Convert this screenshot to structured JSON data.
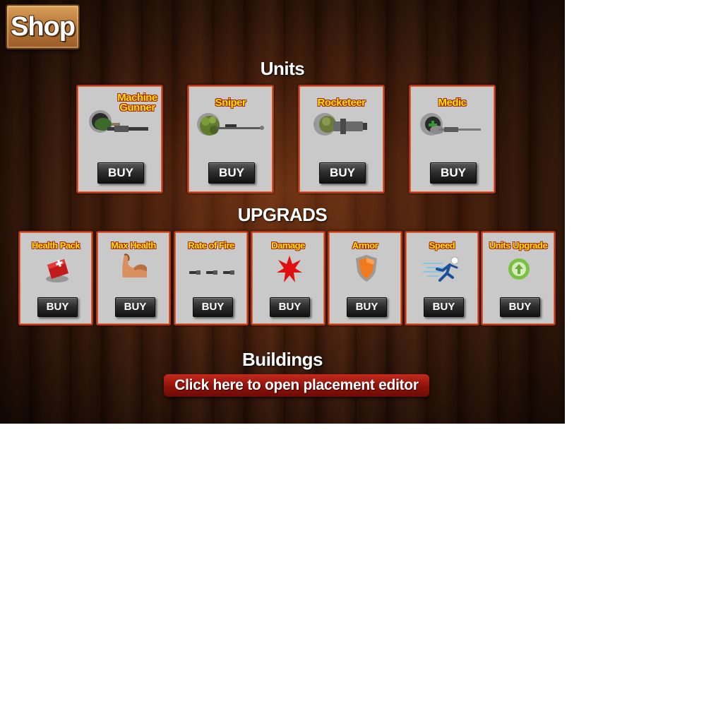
{
  "shop": {
    "title": "Shop"
  },
  "sections": {
    "units": "Units",
    "upgrades": "UPGRADS",
    "buildings": "Buildings"
  },
  "units": [
    {
      "name": "Machine Gunner",
      "line1": "Machine",
      "line2": "Gunner",
      "icon": "machine-gunner-soldier",
      "buy": "BUY"
    },
    {
      "name": "Sniper",
      "icon": "sniper-soldier",
      "buy": "BUY"
    },
    {
      "name": "Rocketeer",
      "icon": "rocketeer-soldier",
      "buy": "BUY"
    },
    {
      "name": "Medic",
      "icon": "medic-soldier",
      "buy": "BUY"
    }
  ],
  "upgrades": [
    {
      "name": "Health Pack",
      "icon": "health-pack-icon",
      "buy": "BUY"
    },
    {
      "name": "Max Health",
      "icon": "flexed-arm-icon",
      "buy": "BUY"
    },
    {
      "name": "Rate of Fire",
      "icon": "bullets-icon",
      "buy": "BUY"
    },
    {
      "name": "Damage",
      "icon": "explosion-icon",
      "buy": "BUY"
    },
    {
      "name": "Armor",
      "icon": "shield-icon",
      "buy": "BUY"
    },
    {
      "name": "Speed",
      "icon": "running-man-icon",
      "buy": "BUY"
    },
    {
      "name": "Units Upgrade",
      "icon": "up-arrow-circle-icon",
      "buy": "BUY"
    }
  ],
  "buildings": {
    "editor_button": "Click here to open placement editor"
  },
  "colors": {
    "card_bg": "#c9c9c9",
    "card_border": "#b5371a",
    "title_yellow": "#ffe400",
    "editor_red": "#8e1209"
  }
}
